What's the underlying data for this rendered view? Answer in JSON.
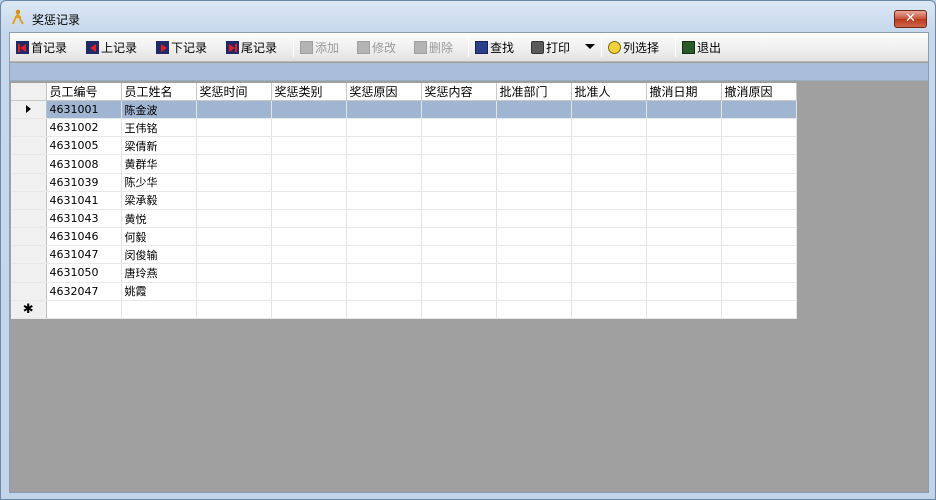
{
  "window": {
    "title": "奖惩记录"
  },
  "toolbar": {
    "first": "首记录",
    "prev": "上记录",
    "next": "下记录",
    "last": "尾记录",
    "add": "添加",
    "edit": "修改",
    "delete": "删除",
    "find": "查找",
    "print": "打印",
    "column_select": "列选择",
    "exit": "退出"
  },
  "grid": {
    "columns": [
      "员工编号",
      "员工姓名",
      "奖惩时间",
      "奖惩类别",
      "奖惩原因",
      "奖惩内容",
      "批准部门",
      "批准人",
      "撤消日期",
      "撤消原因"
    ],
    "rows": [
      [
        "4631001",
        "陈金波"
      ],
      [
        "4631002",
        "王伟铭"
      ],
      [
        "4631005",
        "梁倩新"
      ],
      [
        "4631008",
        "黄群华"
      ],
      [
        "4631039",
        "陈少华"
      ],
      [
        "4631041",
        "梁承毅"
      ],
      [
        "4631043",
        "黄悦"
      ],
      [
        "4631046",
        "何毅"
      ],
      [
        "4631047",
        "闵俊输"
      ],
      [
        "4631050",
        "唐玲燕"
      ],
      [
        "4632047",
        "姚霞"
      ]
    ],
    "selected_row": 0,
    "new_row_marker": "✱"
  },
  "colors": {
    "selection": "#9fb5d2",
    "band": "#a9bfd9",
    "client_bg": "#a0a0a0"
  }
}
